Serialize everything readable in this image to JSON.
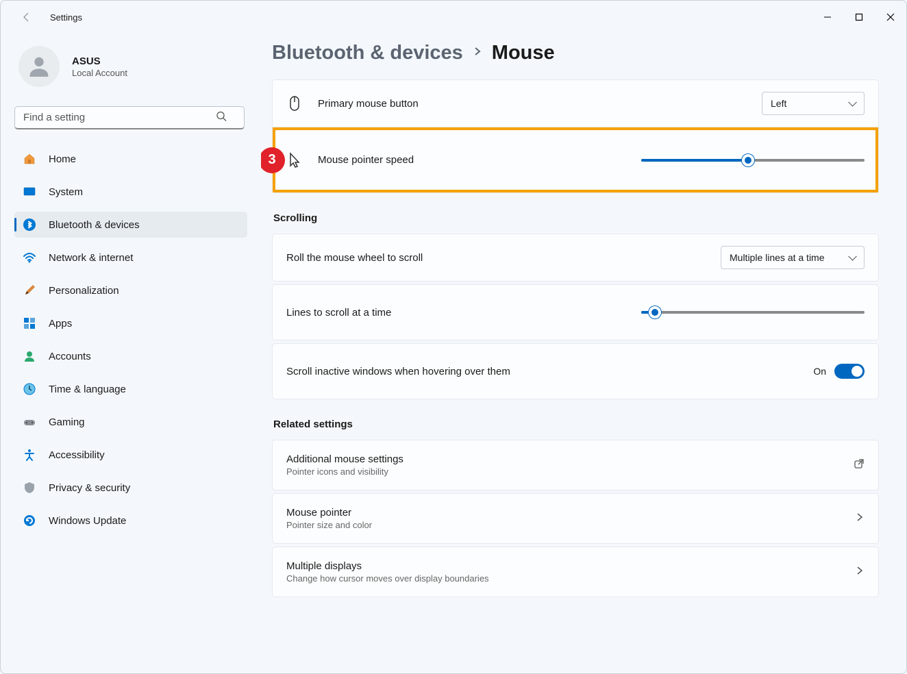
{
  "window": {
    "title": "Settings"
  },
  "profile": {
    "name": "ASUS",
    "subtitle": "Local Account"
  },
  "search": {
    "placeholder": "Find a setting"
  },
  "nav": {
    "items": [
      {
        "label": "Home"
      },
      {
        "label": "System"
      },
      {
        "label": "Bluetooth & devices"
      },
      {
        "label": "Network & internet"
      },
      {
        "label": "Personalization"
      },
      {
        "label": "Apps"
      },
      {
        "label": "Accounts"
      },
      {
        "label": "Time & language"
      },
      {
        "label": "Gaming"
      },
      {
        "label": "Accessibility"
      },
      {
        "label": "Privacy & security"
      },
      {
        "label": "Windows Update"
      }
    ],
    "active_index": 2
  },
  "breadcrumb": {
    "parent": "Bluetooth & devices",
    "current": "Mouse"
  },
  "annotation": {
    "number": "3"
  },
  "settings": {
    "primary_button": {
      "label": "Primary mouse button",
      "value": "Left"
    },
    "pointer_speed": {
      "label": "Mouse pointer speed",
      "value_percent": 48
    },
    "section_scrolling": "Scrolling",
    "wheel_scroll": {
      "label": "Roll the mouse wheel to scroll",
      "value": "Multiple lines at a time"
    },
    "lines_scroll": {
      "label": "Lines to scroll at a time",
      "value_percent": 6
    },
    "scroll_inactive": {
      "label": "Scroll inactive windows when hovering over them",
      "state_label": "On"
    },
    "section_related": "Related settings",
    "additional": {
      "title": "Additional mouse settings",
      "subtitle": "Pointer icons and visibility"
    },
    "mouse_pointer": {
      "title": "Mouse pointer",
      "subtitle": "Pointer size and color"
    },
    "multiple_displays": {
      "title": "Multiple displays",
      "subtitle": "Change how cursor moves over display boundaries"
    }
  }
}
